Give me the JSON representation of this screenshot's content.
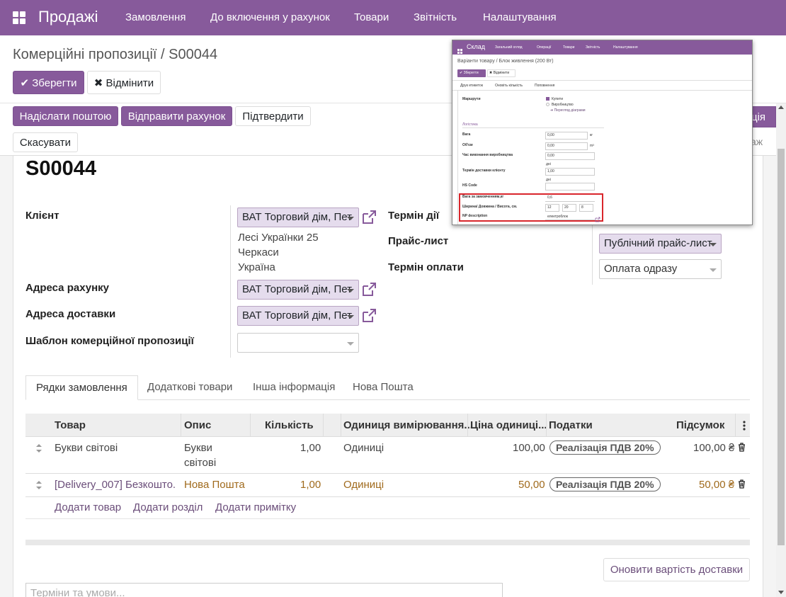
{
  "navbar": {
    "app_title": "Продажі",
    "menu": [
      "Замовлення",
      "До включення у рахунок",
      "Товари",
      "Звітність",
      "Налаштування"
    ]
  },
  "breadcrumb": "Комерційні пропозиції / S00044",
  "actions": {
    "save": "✔ Зберегти",
    "discard": "✖ Відмінити",
    "send_email": "Надіслати поштою",
    "send_invoice": "Відправити рахунок",
    "confirm": "Підтвердити",
    "cancel": "Скасувати",
    "partial_right_1": "ція",
    "partial_right_2": "аж"
  },
  "form": {
    "title": "S00044",
    "client_label": "Клієнт",
    "client_value": "ВАТ Торговий дім, Пет",
    "address": [
      "Лесі Українки 25",
      "Черкаси",
      "Україна"
    ],
    "invoice_addr_label": "Адреса рахунку",
    "invoice_addr_value": "ВАТ Торговий дім, Пет",
    "delivery_addr_label": "Адреса доставки",
    "delivery_addr_value": "ВАТ Торговий дім, Пет",
    "template_label": "Шаблон комерційної пропозиції",
    "validity_label": "Термін дії",
    "pricelist_label": "Прайс-лист",
    "pricelist_value": "Публічний прайс-лист",
    "payment_label": "Термін оплати",
    "payment_value": "Оплата одразу"
  },
  "tabs": [
    "Рядки замовлення",
    "Додаткові товари",
    "Інша інформація",
    "Нова Пошта"
  ],
  "table": {
    "headers": [
      "Товар",
      "Опис",
      "Кількість",
      "Одиниця вимірювання...",
      "Ціна одиниці...",
      "Податки",
      "Підсумок"
    ],
    "rows": [
      {
        "product": "Букви світові",
        "desc1": "Букви",
        "desc2": "світові",
        "qty": "1,00",
        "uom": "Одиниці",
        "price": "100,00",
        "tax": "Реалізація ПДВ 20%",
        "total": "100,00 ₴"
      },
      {
        "product": "[Delivery_007] Безкошто...",
        "desc1": "Нова Пошта",
        "desc2": "",
        "qty": "1,00",
        "uom": "Одиниці",
        "price": "50,00",
        "tax": "Реалізація ПДВ 20%",
        "total": "50,00 ₴"
      }
    ],
    "add_product": "Додати товар",
    "add_section": "Додати розділ",
    "add_note": "Додати примітку"
  },
  "update_shipping": "Оновити вартість доставки",
  "terms_placeholder": "Терміни та умови...",
  "inset": {
    "app": "Склад",
    "menu": [
      "Загальний огляд",
      "Операції",
      "Товари",
      "Звітність",
      "Налаштування"
    ],
    "breadcrumb": "Варіанти товару / Блок живлення (200 Вт)",
    "save": "✔ Зберегти",
    "discard": "✖ Відмінити",
    "tabs": [
      "Друк етикеток",
      "Оновіть кількість",
      "Поповнення"
    ],
    "routes_label": "Маршрути",
    "route_buy": "Купити",
    "route_manufacture": "Виробництво",
    "route_diagram": "➔ Перегляд діаграми",
    "logistics": "Логістика",
    "weight_label": "Вага",
    "weight_value": "0,00",
    "weight_unit": "кг",
    "volume_label": "Об'єм",
    "volume_value": "0,00",
    "volume_unit": "m³",
    "mfg_label": "Час виконання виробництва",
    "mfg_value": "0,00",
    "mfg_unit": "дні",
    "lead_label": "Термін доставки клієнту",
    "lead_value": "1,00",
    "lead_unit": "дні",
    "hs_label": "HS Code",
    "np_weight_label": "Вага за замовченням,кг",
    "np_weight_value": "0,6",
    "np_dims_label": "Ширина/ Довжина / Висота, см.",
    "np_dims": [
      "12",
      "20",
      "8"
    ],
    "np_desc_label": "NP description",
    "np_desc_value": "електроблок"
  },
  "colors": {
    "brand": "#875a9b",
    "highlight": "#d9262c",
    "delivery_row": "#a06a1c"
  }
}
